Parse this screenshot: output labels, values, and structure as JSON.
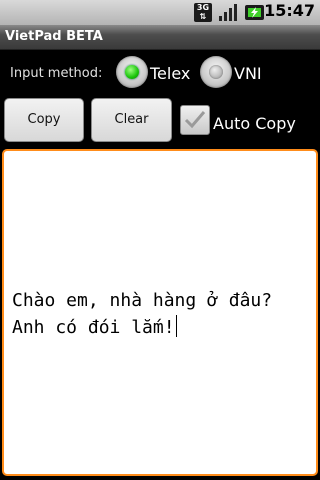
{
  "status_bar": {
    "network": "3G",
    "time": "15:47",
    "icons": [
      "3g-icon",
      "signal-icon",
      "battery-charging-icon"
    ]
  },
  "app": {
    "title": "VietPad BETA"
  },
  "input_method": {
    "label": "Input method:",
    "options": [
      {
        "label": "Telex",
        "selected": true
      },
      {
        "label": "VNI",
        "selected": false
      }
    ]
  },
  "toolbar": {
    "copy_label": "Copy",
    "clear_label": "Clear",
    "auto_copy_label": "Auto Copy",
    "auto_copy_checked": true
  },
  "editor": {
    "text": "Chào em, nhà hàng ở đâu? Anh có đói lắm!"
  },
  "colors": {
    "accent_focus": "#ff8c1a",
    "radio_selected": "#19c40a"
  }
}
